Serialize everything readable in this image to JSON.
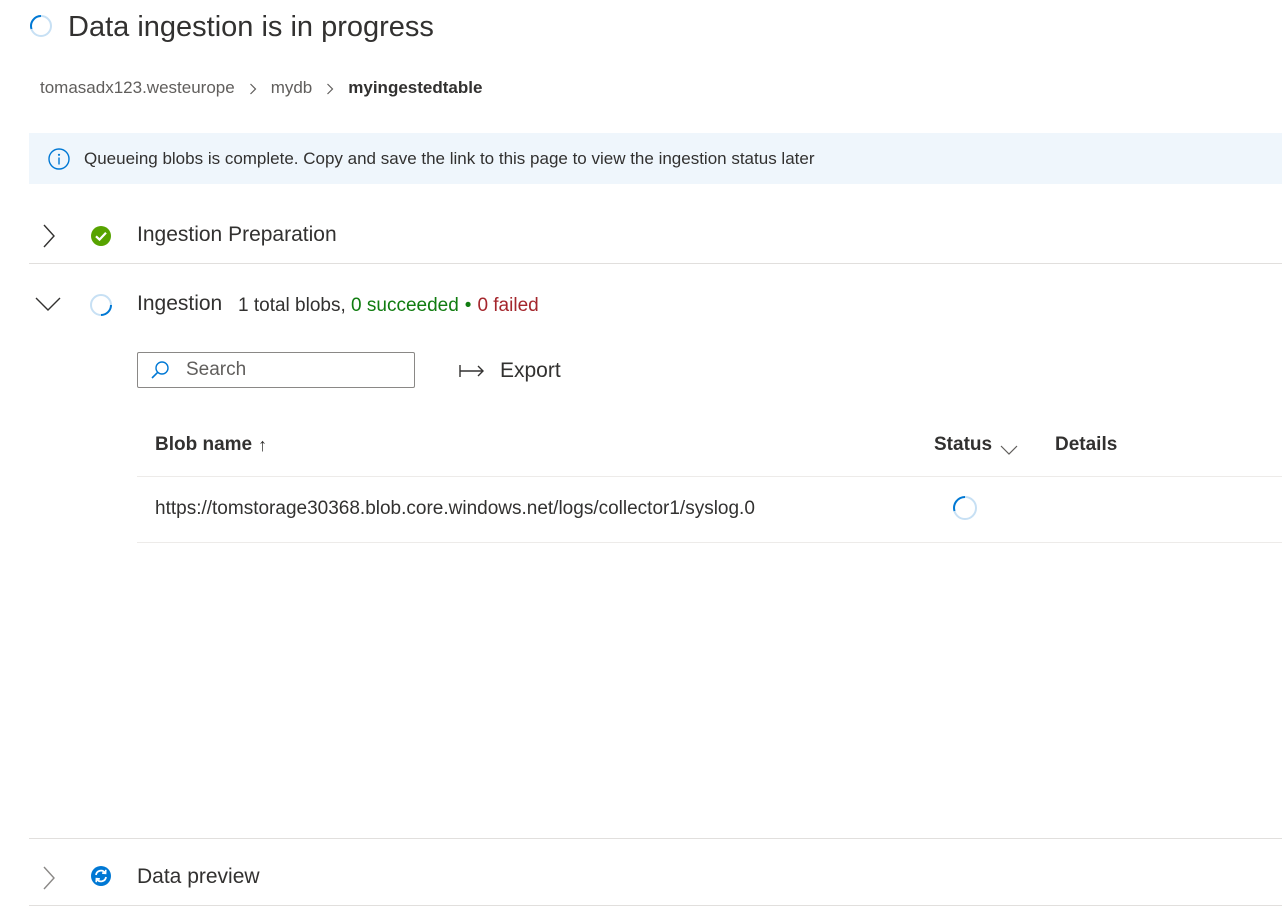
{
  "header": {
    "title": "Data ingestion is in progress",
    "status_icon": "spinner-icon"
  },
  "breadcrumb": {
    "items": [
      "tomasadx123.westeurope",
      "mydb",
      "myingestedtable"
    ]
  },
  "banner": {
    "icon": "info-icon",
    "text": "Queueing blobs is complete. Copy and save the link to this page to view the ingestion status later"
  },
  "sections": {
    "preparation": {
      "title": "Ingestion Preparation",
      "state": "collapsed",
      "status_icon": "check-circle-icon"
    },
    "ingestion": {
      "title": "Ingestion",
      "state": "expanded",
      "status_icon": "spinner-icon",
      "summary_total": "1 total blobs,",
      "summary_succeeded": "0 succeeded",
      "summary_separator": "•",
      "summary_failed": "0 failed"
    },
    "preview": {
      "title": "Data preview",
      "state": "collapsed",
      "status_icon": "refresh-icon"
    }
  },
  "toolbar": {
    "search_placeholder": "Search",
    "search_value": "",
    "export_label": "Export"
  },
  "table": {
    "columns": {
      "blob_name": "Blob name",
      "blob_sort": "↑",
      "status": "Status",
      "details": "Details"
    },
    "rows": [
      {
        "blob_name": "https://tomstorage30368.blob.core.windows.net/logs/collector1/syslog.0",
        "status": "in-progress",
        "details": ""
      }
    ]
  },
  "colors": {
    "accent": "#0078d4",
    "success": "#107c10",
    "success_icon": "#57a300",
    "failure": "#a4262c",
    "banner_bg": "#eff6fc",
    "divider": "#e1dfdd"
  }
}
